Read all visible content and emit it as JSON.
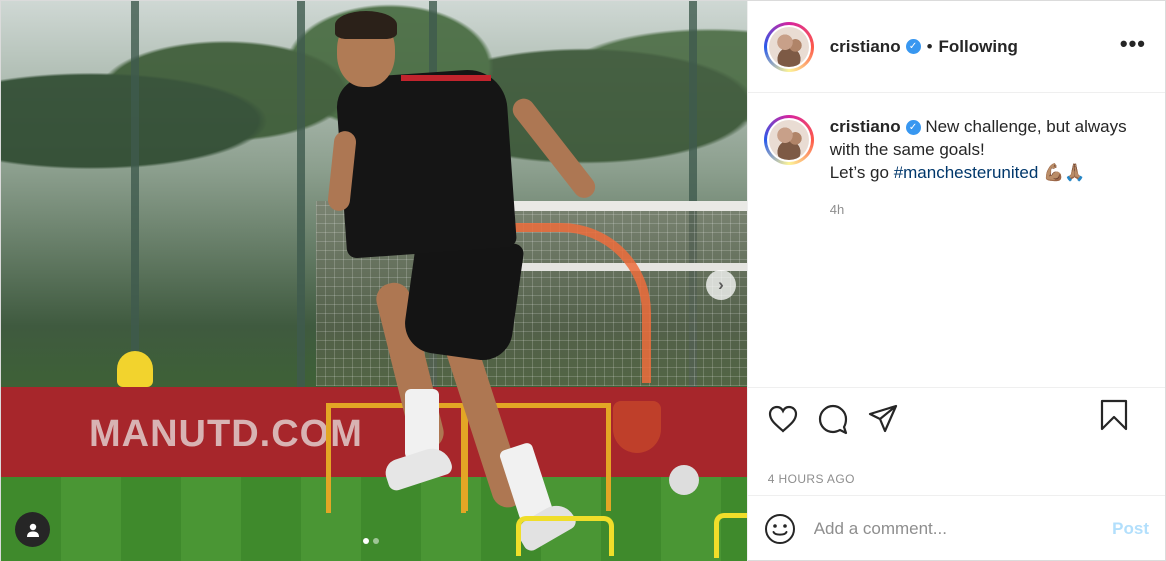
{
  "header": {
    "username": "cristiano",
    "separator": "•",
    "follow_status": "Following",
    "more": "•••"
  },
  "media": {
    "banner_text": "MANUTD.COM",
    "next_icon": "›",
    "slide_count": 2,
    "active_slide": 1
  },
  "caption": {
    "username": "cristiano",
    "line1": "New challenge, but always with the same goals!",
    "line2_prefix": "Let’s go ",
    "hashtag": "#manchesterunited",
    "emoji": "💪🏽🙏🏽",
    "time": "4h"
  },
  "actions": {
    "icons": [
      "heart-icon",
      "comment-icon",
      "share-icon",
      "bookmark-icon"
    ]
  },
  "posted": {
    "label": "4 HOURS AGO"
  },
  "add_comment": {
    "placeholder": "Add a comment...",
    "post_label": "Post"
  },
  "colors": {
    "verified": "#3897f0",
    "hashtag": "#00376b",
    "post_button": "#b2dffc",
    "muted": "#8e8e8e"
  }
}
